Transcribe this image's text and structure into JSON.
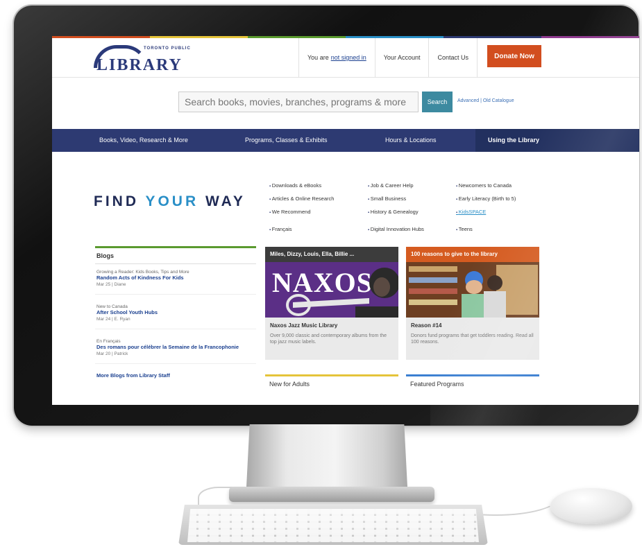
{
  "colors": {
    "brand_blue": "#2d3a72",
    "donate_orange": "#d24e1f",
    "search_teal": "#3d8aa0",
    "find_accent": "#2a8fc7",
    "blogs_green": "#5a9a2e",
    "naxos_purple": "#5b2f86",
    "reasons_orange": "#d55b20",
    "adults_yellow": "#e5c43a",
    "featured_blue": "#3b7fd1"
  },
  "header": {
    "logo_small": "TORONTO PUBLIC",
    "logo_main": "LIBRARY",
    "signin_prefix": "You are",
    "signin_link": "not signed in",
    "account": "Your Account",
    "contact": "Contact Us",
    "donate": "Donate Now"
  },
  "search": {
    "placeholder": "Search books, movies, branches, programs & more",
    "button": "Search",
    "links": "Advanced | Old Catalogue"
  },
  "nav": {
    "items": [
      "Books, Video, Research & More",
      "Programs, Classes & Exhibits",
      "Hours & Locations",
      "Using the Library"
    ]
  },
  "find": {
    "w1": "FIND",
    "w2": "YOUR",
    "w3": "WAY",
    "col1": [
      "Downloads & eBooks",
      "Articles & Online Research",
      "We Recommend",
      "Français"
    ],
    "col2": [
      "Job & Career Help",
      "Small Business",
      "History & Genealogy",
      "Digital Innovation Hubs"
    ],
    "col3": [
      "Newcomers to Canada",
      "Early Literacy (Birth to 5)",
      "KidsSPACE",
      "Teens"
    ]
  },
  "blogs": {
    "heading": "Blogs",
    "items": [
      {
        "cat": "Growing a Reader: Kids Books, Tips and More",
        "title": "Random Acts of Kindness For Kids",
        "meta": "Mar 25 | Diane"
      },
      {
        "cat": "New to Canada",
        "title": "After School Youth Hubs",
        "meta": "Mar 24 | E. Ryan"
      },
      {
        "cat": "En Français",
        "title": "Des romans pour célébrer la Semaine de la Francophonie",
        "meta": "Mar 20 | Patrick"
      },
      {
        "cat": "",
        "title": "More Blogs from Library Staff",
        "meta": ""
      }
    ]
  },
  "cards": {
    "naxos": {
      "head": "Miles, Dizzy, Louis, Ella, Billie ...",
      "image_text": "NAXOS",
      "title": "Naxos Jazz Music Library",
      "text": "Over 9,000 classic and contemporary albums from the top jazz music labels."
    },
    "reasons": {
      "head": "100 reasons to give to the library",
      "title": "Reason #14",
      "text": "Donors fund programs that get toddlers reading. Read all 100 reasons."
    }
  },
  "sections": {
    "adults": "New for Adults",
    "featured": "Featured Programs"
  }
}
